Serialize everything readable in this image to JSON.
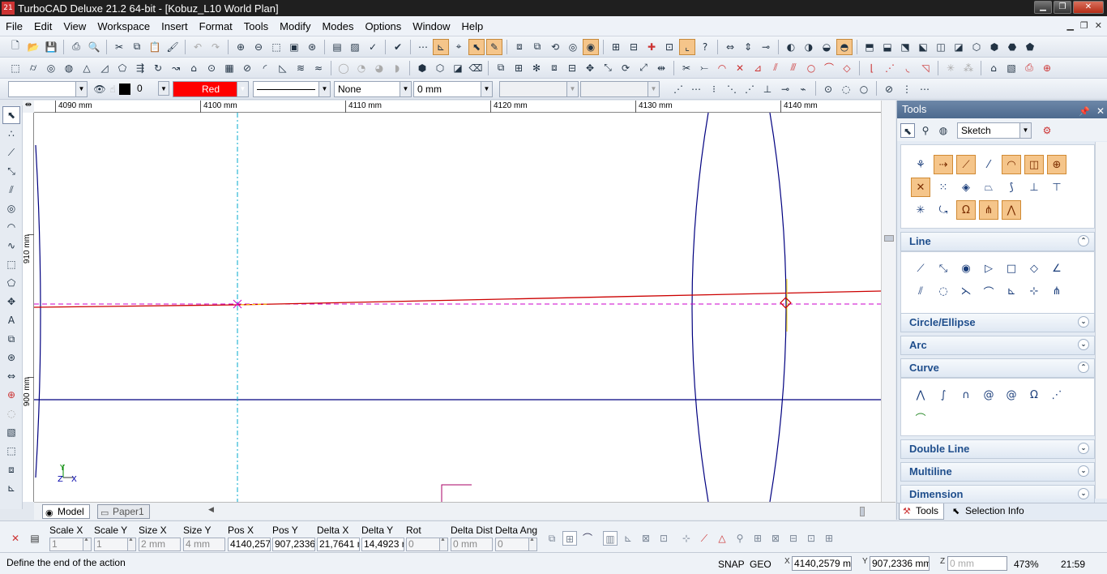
{
  "window": {
    "title": "TurboCAD Deluxe 21.2 64-bit - [Kobuz_L10 World Plan]",
    "app_icon": "21"
  },
  "menu": [
    "File",
    "Edit",
    "View",
    "Workspace",
    "Insert",
    "Format",
    "Tools",
    "Modify",
    "Modes",
    "Options",
    "Window",
    "Help"
  ],
  "property_bar": {
    "layer": "",
    "pen_width_value": "0",
    "color": "Red",
    "color_hex": "#ff0000",
    "pattern": "None",
    "thickness": "0 mm"
  },
  "ruler": {
    "h_labels": [
      "4090 mm",
      "4100 mm",
      "4110 mm",
      "4120 mm",
      "4130 mm",
      "4140 mm"
    ],
    "v_labels": [
      "910 mm",
      "900 mm"
    ]
  },
  "tabs": {
    "model": "Model",
    "paper": "Paper1"
  },
  "palette": {
    "title": "Tools",
    "mode": "Sketch",
    "sections": [
      "Line",
      "Circle/Ellipse",
      "Arc",
      "Curve",
      "Double Line",
      "Multiline",
      "Dimension"
    ],
    "bottom_tabs": {
      "tools": "Tools",
      "selection": "Selection Info"
    }
  },
  "inspector": {
    "fields": [
      {
        "label": "Scale X",
        "value": "1"
      },
      {
        "label": "Scale Y",
        "value": "1"
      },
      {
        "label": "Size X",
        "value": "2 mm"
      },
      {
        "label": "Size Y",
        "value": "4 mm"
      },
      {
        "label": "Pos X",
        "value": "4140,2579"
      },
      {
        "label": "Pos Y",
        "value": "907,2336"
      },
      {
        "label": "Delta X",
        "value": "21,7641 n"
      },
      {
        "label": "Delta Y",
        "value": "14,4923 n"
      },
      {
        "label": "Rot",
        "value": "0"
      },
      {
        "label": "Delta Dist",
        "value": "0 mm"
      },
      {
        "label": "Delta Ang",
        "value": "0"
      }
    ]
  },
  "status": {
    "message": "Define the end of the action",
    "snap": "SNAP",
    "geo": "GEO",
    "x": "4140,2579 mm",
    "y": "907,2336 mm",
    "z": "0 mm",
    "zoom": "473%",
    "time": "21:59"
  },
  "drawing": {
    "axis_y": "Y",
    "axis_z": "Z",
    "axis_x": "X",
    "construction_color": "#cc00cc",
    "line_red": "#cc0000",
    "line_blue": "#000080",
    "guide_cyan": "#00aacc"
  }
}
